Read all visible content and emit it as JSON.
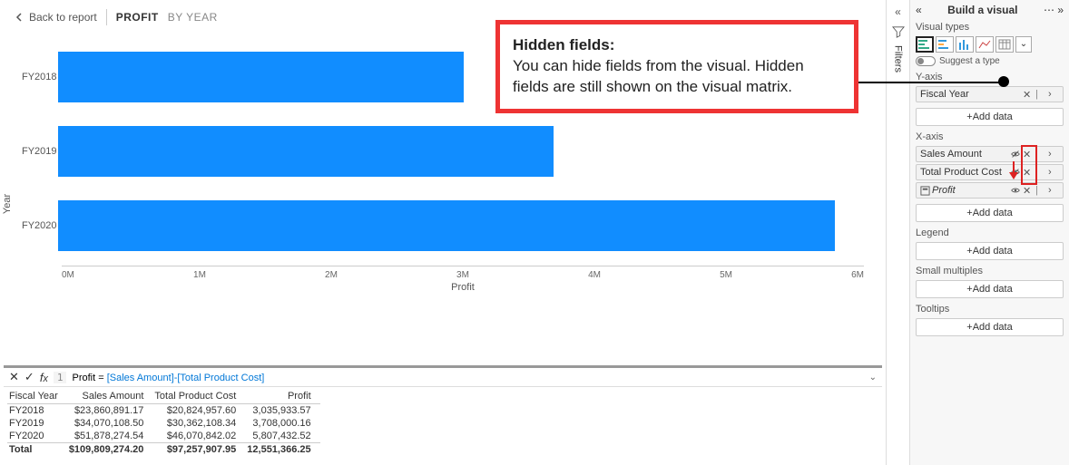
{
  "topbar": {
    "back": "Back to report",
    "crumb_active": "PROFIT",
    "crumb": "BY YEAR"
  },
  "chart_data": {
    "type": "bar",
    "orientation": "horizontal",
    "categories": [
      "FY2018",
      "FY2019",
      "FY2020"
    ],
    "values": [
      3035933.57,
      3708000.16,
      5807432.52
    ],
    "xlabel": "Profit",
    "ylabel": "Year",
    "xlim": [
      0,
      6000000
    ],
    "xticks": [
      "0M",
      "1M",
      "2M",
      "3M",
      "4M",
      "5M",
      "6M"
    ],
    "color": "#118dff"
  },
  "formula": {
    "line": "1",
    "name": "Profit",
    "expr_lhs": "Profit = ",
    "expr_rhs": "[Sales Amount]-[Total Product Cost]"
  },
  "table": {
    "headers": [
      "Fiscal Year",
      "Sales Amount",
      "Total Product Cost",
      "Profit"
    ],
    "rows": [
      [
        "FY2018",
        "$23,860,891.17",
        "$20,824,957.60",
        "3,035,933.57"
      ],
      [
        "FY2019",
        "$34,070,108.50",
        "$30,362,108.34",
        "3,708,000.16"
      ],
      [
        "FY2020",
        "$51,878,274.54",
        "$46,070,842.02",
        "5,807,432.52"
      ]
    ],
    "total": [
      "Total",
      "$109,809,274.20",
      "$97,257,907.95",
      "12,551,366.25"
    ]
  },
  "filters_label": "Filters",
  "build": {
    "title": "Build a visual",
    "visual_types": "Visual types",
    "suggest": "Suggest a type",
    "yaxis_label": "Y-axis",
    "xaxis_label": "X-axis",
    "legend_label": "Legend",
    "small_multiples_label": "Small multiples",
    "tooltips_label": "Tooltips",
    "add_data": "+Add data",
    "yaxis_field": "Fiscal Year",
    "xaxis_fields": [
      "Sales Amount",
      "Total Product Cost",
      "Profit"
    ]
  },
  "callout": {
    "title": "Hidden fields:",
    "body": "You can hide fields from the visual. Hidden fields are still shown on the visual matrix."
  }
}
